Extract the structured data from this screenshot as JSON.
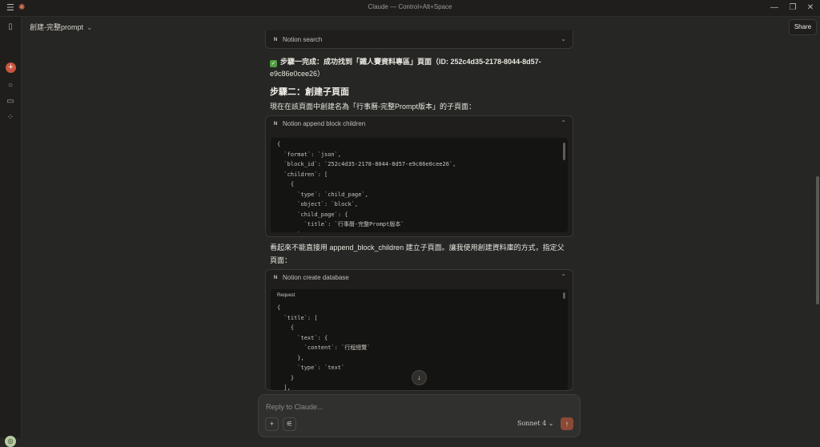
{
  "window": {
    "title": "Claude — Control+Alt+Space",
    "menu_icon": "☰",
    "logo_icon": "✺",
    "minimize": "—",
    "restore": "❐",
    "close": "✕"
  },
  "sidebar": {
    "new_chat_icon": "+",
    "avatar": "◎"
  },
  "header": {
    "chat_title": "創建-完整prompt",
    "chevron": "⌄",
    "share_label": "Share"
  },
  "messages": {
    "notion_search_label": "Notion search",
    "step1_line1": "步驟一完成：成功找到「鐵人賽資料專區」頁面（ID: 252c4d35-2178-8044-8d57-",
    "step1_line2": "e9c86e0cee26）",
    "step2_heading": "步驟二：創建子頁面",
    "step2_text": "現在在該頁面中創建名為「行事曆-完整Prompt版本」的子頁面：",
    "append_label": "Notion append block children",
    "append_code": [
      "{",
      "  `format`: `json`,",
      "  `block_id`: `252c4d35-2178-8044-8d57-e9c86e0cee26`,",
      "  `children`: [",
      "    {",
      "      `type`: `child_page`,",
      "      `object`: `block`,",
      "      `child_page`: {",
      "        `title`: `行事曆-完整Prompt版本`",
      "      }"
    ],
    "note_line1": "看起來不能直接用 append_block_children 建立子頁面。讓我使用創建資料庫的方式，指定父",
    "note_line2": "頁面：",
    "create_db_label": "Notion create database",
    "request_label": "Request",
    "create_code": [
      "{",
      "  `title`: [",
      "    {",
      "      `text`: {",
      "        `content`: `行程總覽`",
      "      },",
      "      `type`: `text`",
      "    }",
      "  ],"
    ]
  },
  "composer": {
    "placeholder": "Reply to Claude...",
    "add_icon": "+",
    "tools_icon": "⚟",
    "model_label": "Sonnet 4",
    "model_chevron": "⌄",
    "send_icon": "↑",
    "scroll_down_icon": "↓"
  }
}
